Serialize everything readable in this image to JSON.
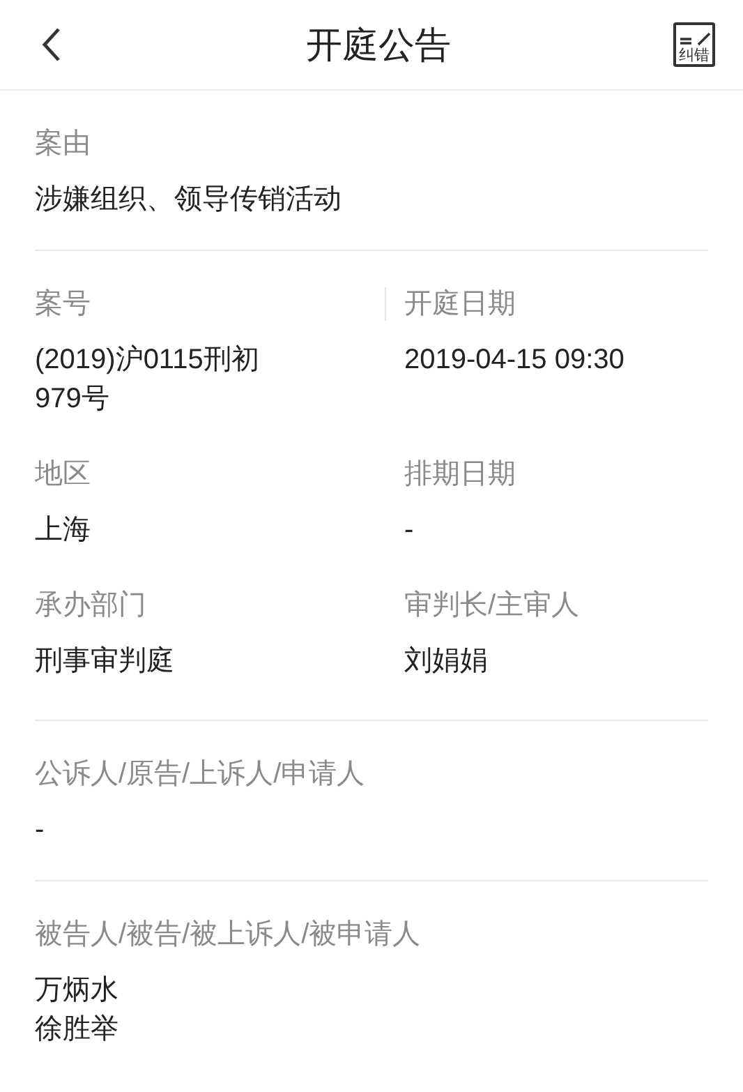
{
  "header": {
    "title": "开庭公告",
    "correction_button": {
      "label": "纠错"
    }
  },
  "sections": [
    {
      "kind": "single",
      "label": "案由",
      "values": [
        "涉嫌组织、领导传销活动"
      ]
    },
    {
      "kind": "pairs",
      "rows": [
        [
          {
            "label": "案号",
            "value": "(2019)沪0115刑初979号"
          },
          {
            "label": "开庭日期",
            "value": "2019-04-15 09:30"
          }
        ],
        [
          {
            "label": "地区",
            "value": "上海"
          },
          {
            "label": "排期日期",
            "value": "-"
          }
        ],
        [
          {
            "label": "承办部门",
            "value": "刑事审判庭"
          },
          {
            "label": "审判长/主审人",
            "value": "刘娟娟"
          }
        ]
      ]
    },
    {
      "kind": "single",
      "label": "公诉人/原告/上诉人/申请人",
      "values": [
        "-"
      ]
    },
    {
      "kind": "single",
      "label": "被告人/被告/被上诉人/被申请人",
      "values": [
        "万炳水",
        "徐胜举"
      ]
    }
  ]
}
